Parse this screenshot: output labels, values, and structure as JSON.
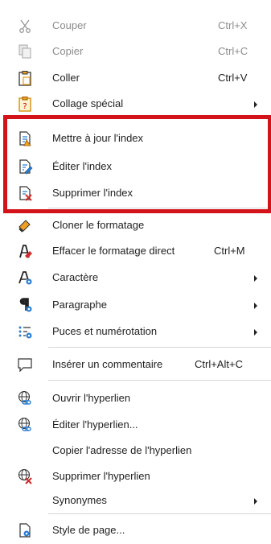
{
  "menu": {
    "cut": {
      "label": "Couper",
      "shortcut": "Ctrl+X"
    },
    "copy": {
      "label": "Copier",
      "shortcut": "Ctrl+C"
    },
    "paste": {
      "label": "Coller",
      "shortcut": "Ctrl+V"
    },
    "paste_special": {
      "label": "Collage spécial"
    },
    "update_index": {
      "label": "Mettre à jour l'index"
    },
    "edit_index": {
      "label": "Éditer l'index"
    },
    "delete_index": {
      "label": "Supprimer l'index"
    },
    "clone_formatting": {
      "label": "Cloner le formatage"
    },
    "clear_direct_formatting": {
      "label": "Effacer le formatage direct",
      "shortcut": "Ctrl+M"
    },
    "character": {
      "label": "Caractère"
    },
    "paragraph": {
      "label": "Paragraphe"
    },
    "bullets_numbering": {
      "label": "Puces et numérotation"
    },
    "insert_comment": {
      "label": "Insérer un commentaire",
      "shortcut": "Ctrl+Alt+C"
    },
    "open_hyperlink": {
      "label": "Ouvrir l'hyperlien"
    },
    "edit_hyperlink": {
      "label": "Éditer l'hyperlien..."
    },
    "copy_hyperlink_address": {
      "label": "Copier l'adresse de l'hyperlien"
    },
    "remove_hyperlink": {
      "label": "Supprimer l'hyperlien"
    },
    "synonyms": {
      "label": "Synonymes"
    },
    "page_style": {
      "label": "Style de page..."
    }
  },
  "colors": {
    "highlight_border": "#d3121a",
    "disabled_text": "#8c8c8c",
    "accent_blue": "#2a7fd4",
    "accent_orange": "#f0a020",
    "accent_red": "#d42a2a"
  }
}
